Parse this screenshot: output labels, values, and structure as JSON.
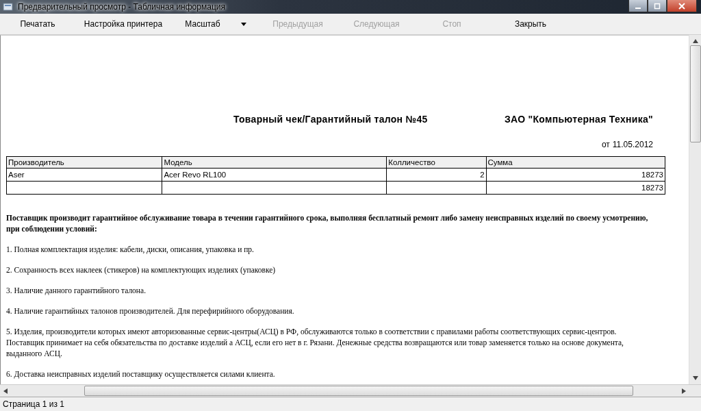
{
  "window": {
    "title": "Предварительный просмотр - Табличная информация"
  },
  "toolbar": [
    {
      "label": "Печатать",
      "disabled": false,
      "kind": "button"
    },
    {
      "label": "Настройка принтера",
      "disabled": false,
      "kind": "button"
    },
    {
      "label": "Масштаб",
      "disabled": false,
      "kind": "dropdown"
    },
    {
      "label": "Предыдущая",
      "disabled": true,
      "kind": "button"
    },
    {
      "label": "Следующая",
      "disabled": true,
      "kind": "button"
    },
    {
      "label": "Стоп",
      "disabled": true,
      "kind": "button"
    },
    {
      "label": "Закрыть",
      "disabled": false,
      "kind": "button"
    }
  ],
  "document": {
    "title": "Товарный чек/Гарантийный талон №45",
    "company": "ЗАО \"Компьютерная Техника\"",
    "date_prefix": "от",
    "date": "11.05.2012",
    "table": {
      "columns": [
        "Производитель",
        "Модель",
        "Колличество",
        "Сумма"
      ],
      "rows": [
        [
          "Aser",
          "Acer Revo RL100",
          "2",
          "18273"
        ],
        [
          "",
          "",
          "",
          "18273"
        ]
      ]
    },
    "paragraphs": [
      {
        "text": "Поставщик производит гарантийное обслуживание товара в течении гарантийного срока, выполняя бесплатный ремонт либо замену неисправных изделий по своему усмотрению, при соблюдении условий:",
        "bold": true
      },
      {
        "text": "1. Полная комплектация изделия: кабели, диски, описания, упаковка и пр.",
        "bold": false
      },
      {
        "text": "2. Сохранность всех наклеек (стикеров) на комплектующих изделиях (упаковке)",
        "bold": false
      },
      {
        "text": "3. Наличие данного гарантийного талона.",
        "bold": false
      },
      {
        "text": "4. Наличие гарантийных талонов производителей. Для перефирийного оборудования.",
        "bold": false
      },
      {
        "text": "5. Изделия, производители которых имеют авторизованные сервис-центры(АСЦ) в РФ, обслуживаются только в соответствии с правилами работы соответствующих сервис-центров. Поставщик принимает на себя обязательства по доставке изделий а АСЦ, если его нет в г. Рязани. Денежные средства возвращаются или товар заменяется только на основе документа, выданного АСЦ.",
        "bold": false
      },
      {
        "text": "6. Доставка неисправных изделий поставщику осуществляется силами клиента.",
        "bold": false
      }
    ]
  },
  "status_bar": {
    "text": "Страница 1 из 1"
  }
}
